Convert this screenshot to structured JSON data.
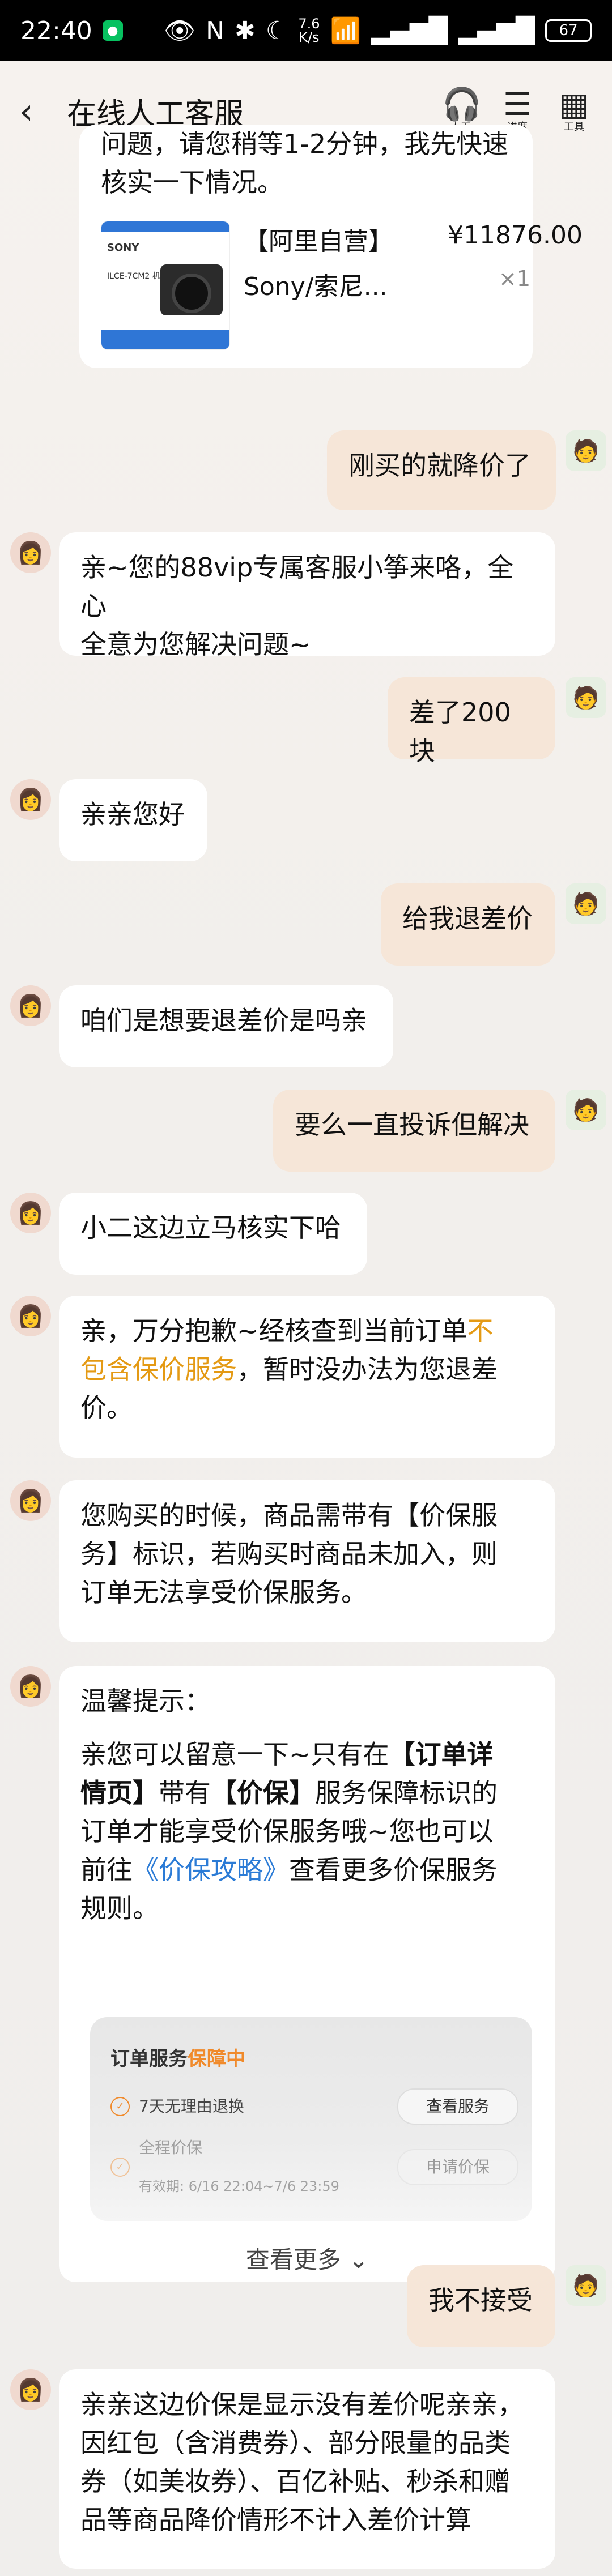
{
  "status": {
    "time": "22:40",
    "speed_value": "7.6",
    "speed_unit": "K/s",
    "battery": "67"
  },
  "nav": {
    "title": "在线人工客服",
    "actions": [
      {
        "label": "人工"
      },
      {
        "label": "进度"
      },
      {
        "label": "工具"
      }
    ]
  },
  "product": {
    "intro_line1": "问题，请您稍等1-2分钟，我先快速",
    "intro_line2": "核实一下情况。",
    "tag": "【阿里自营】",
    "price": "¥11876.00",
    "name": "Sony/索尼...",
    "qty": "×1"
  },
  "thumb": {
    "brand": "SONY",
    "model": "ILCE-7CM2 机身"
  },
  "messages": {
    "m1": "刚买的就降价了",
    "m2_line1": "亲~您的88vip专属客服小筝来咯，全心",
    "m2_line2": "全意为您解决问题~",
    "m3": "差了200块",
    "m4": "亲亲您好",
    "m5": "给我退差价",
    "m6": "咱们是想要退差价是吗亲",
    "m7": "要么一直投诉但解决",
    "m8": "小二这边立马核实下哈",
    "m9_a": "亲，万分抱歉~经核查到当前订单",
    "m9_b": "不",
    "m9_c": "包含保价服务",
    "m9_d": "，暂时没办法为您退差",
    "m9_e": "价。",
    "m10_line1": "您购买的时候，商品需带有【价保服",
    "m10_line2": "务】标识，若购买时商品未加入，则",
    "m10_line3": "订单无法享受价保服务。",
    "m11_title": "温馨提示：",
    "m11_l1_a": "亲您可以留意一下~只有在",
    "m11_l1_b": "【订单详",
    "m11_l2_a": "情页】",
    "m11_l2_b": "带有",
    "m11_l2_c": "【价保】",
    "m11_l2_d": "服务保障标识的",
    "m11_l3": "订单才能享受价保服务哦~您也可以",
    "m11_l4_a": "前往",
    "m11_l4_b": "《价保攻略》",
    "m11_l4_c": "查看更多价保服务",
    "m11_l5": "规则。",
    "m12": "我不接受",
    "m13_l1": "亲亲这边价保是显示没有差价呢亲亲，",
    "m13_l2": "因红包（含消费券）、部分限量的品类",
    "m13_l3": "券（如美妆券）、百亿补贴、秒杀和赠",
    "m13_l4": "品等商品降价情形不计入差价计算"
  },
  "order_card": {
    "title_prefix": "订单服务",
    "title_status": "保障中",
    "row1": "7天无理由退换",
    "row1_btn": "查看服务",
    "row2": "全程价保",
    "row2_sub": "有效期: 6/16 22:04~7/6 23:59",
    "row2_btn": "申请价保",
    "more": "查看更多"
  }
}
